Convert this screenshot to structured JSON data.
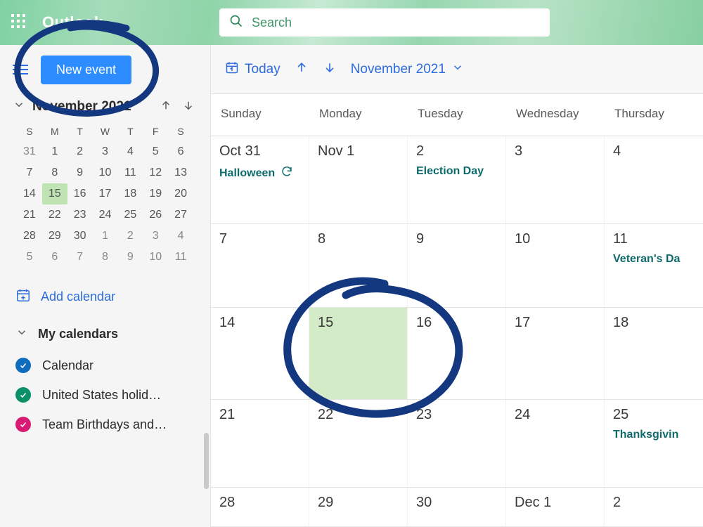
{
  "brand": "Outlook",
  "search": {
    "placeholder": "Search"
  },
  "sidebar": {
    "new_event": "New event",
    "month_label": "November 2021",
    "dow": [
      "S",
      "M",
      "T",
      "W",
      "T",
      "F",
      "S"
    ],
    "mini_weeks": [
      [
        {
          "d": "31",
          "off": true
        },
        {
          "d": "1"
        },
        {
          "d": "2"
        },
        {
          "d": "3"
        },
        {
          "d": "4"
        },
        {
          "d": "5"
        },
        {
          "d": "6"
        }
      ],
      [
        {
          "d": "7"
        },
        {
          "d": "8"
        },
        {
          "d": "9"
        },
        {
          "d": "10"
        },
        {
          "d": "11"
        },
        {
          "d": "12"
        },
        {
          "d": "13"
        }
      ],
      [
        {
          "d": "14"
        },
        {
          "d": "15",
          "sel": true
        },
        {
          "d": "16"
        },
        {
          "d": "17"
        },
        {
          "d": "18"
        },
        {
          "d": "19"
        },
        {
          "d": "20"
        }
      ],
      [
        {
          "d": "21"
        },
        {
          "d": "22"
        },
        {
          "d": "23"
        },
        {
          "d": "24"
        },
        {
          "d": "25"
        },
        {
          "d": "26"
        },
        {
          "d": "27"
        }
      ],
      [
        {
          "d": "28"
        },
        {
          "d": "29"
        },
        {
          "d": "30"
        },
        {
          "d": "1",
          "off": true
        },
        {
          "d": "2",
          "off": true
        },
        {
          "d": "3",
          "off": true
        },
        {
          "d": "4",
          "off": true
        }
      ],
      [
        {
          "d": "5",
          "off": true
        },
        {
          "d": "6",
          "off": true
        },
        {
          "d": "7",
          "off": true
        },
        {
          "d": "8",
          "off": true
        },
        {
          "d": "9",
          "off": true
        },
        {
          "d": "10",
          "off": true
        },
        {
          "d": "11",
          "off": true
        }
      ]
    ],
    "add_calendar": "Add calendar",
    "group_label": "My calendars",
    "calendars": [
      {
        "name": "Calendar",
        "color": "#0f6cbd"
      },
      {
        "name": "United States holid…",
        "color": "#0d8f68"
      },
      {
        "name": "Team Birthdays and…",
        "color": "#d71b72"
      }
    ]
  },
  "toolbar": {
    "today": "Today",
    "range_label": "November 2021"
  },
  "big_dow": [
    "Sunday",
    "Monday",
    "Tuesday",
    "Wednesday",
    "Thursday"
  ],
  "big_weeks": [
    [
      {
        "date": "Oct 31",
        "event": "Halloween",
        "refresh": true
      },
      {
        "date": "Nov 1"
      },
      {
        "date": "2",
        "event": "Election Day"
      },
      {
        "date": "3"
      },
      {
        "date": "4"
      }
    ],
    [
      {
        "date": "7"
      },
      {
        "date": "8"
      },
      {
        "date": "9"
      },
      {
        "date": "10"
      },
      {
        "date": "11",
        "event": "Veteran's Da"
      }
    ],
    [
      {
        "date": "14"
      },
      {
        "date": "15",
        "sel": true
      },
      {
        "date": "16"
      },
      {
        "date": "17"
      },
      {
        "date": "18"
      }
    ],
    [
      {
        "date": "21"
      },
      {
        "date": "22"
      },
      {
        "date": "23"
      },
      {
        "date": "24"
      },
      {
        "date": "25",
        "event": "Thanksgivin"
      }
    ],
    [
      {
        "date": "28"
      },
      {
        "date": "29"
      },
      {
        "date": "30"
      },
      {
        "date": "Dec 1"
      },
      {
        "date": "2"
      }
    ]
  ],
  "annotations": {
    "circle_new_event": true,
    "circle_day_15": true
  }
}
